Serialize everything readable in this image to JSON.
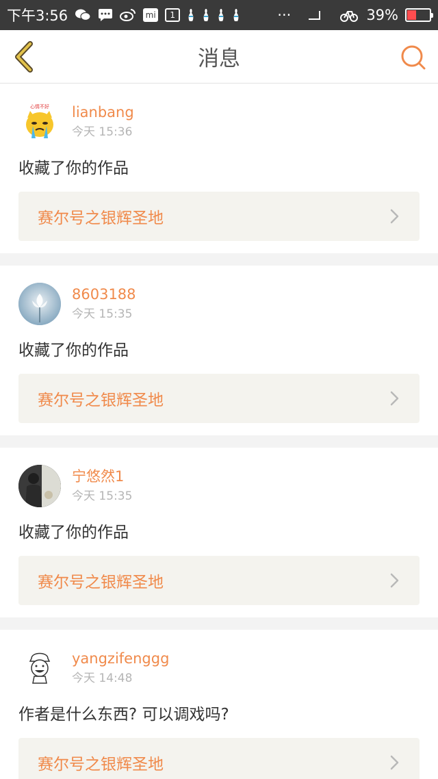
{
  "status_bar": {
    "time": "下午3:56",
    "battery": "39%",
    "battery_level": 0.39,
    "left_icons": [
      "wechat-icon",
      "message-icon",
      "weibo-icon",
      "mi-icon",
      "calendar-icon",
      "bowling-pin-icon",
      "bowling-pin-icon",
      "bowling-pin-icon",
      "bowling-pin-icon"
    ],
    "overflow": "···",
    "right_icons": [
      "signal-icon",
      "bike-icon"
    ]
  },
  "header": {
    "title": "消息",
    "back_icon": "back-chevron-icon",
    "search_icon": "search-icon",
    "accent_color": "#f08a4b",
    "back_color": "#c6a84a"
  },
  "notifications": [
    {
      "username": "lianbang",
      "time": "今天 15:36",
      "message": "收藏了你的作品",
      "work_title": "赛尔号之银辉圣地",
      "avatar_badge": "心情不好"
    },
    {
      "username": "8603188",
      "time": "今天 15:35",
      "message": "收藏了你的作品",
      "work_title": "赛尔号之银辉圣地"
    },
    {
      "username": "宁悠然1",
      "time": "今天 15:35",
      "message": "收藏了你的作品",
      "work_title": "赛尔号之银辉圣地"
    },
    {
      "username": "yangzifenggg",
      "time": "今天 14:48",
      "message": "作者是什么东西? 可以调戏吗?",
      "work_title": "赛尔号之银辉圣地"
    }
  ]
}
